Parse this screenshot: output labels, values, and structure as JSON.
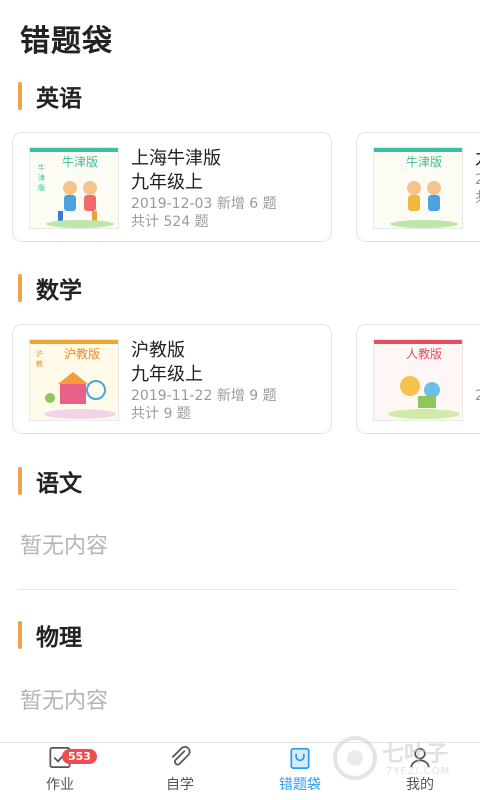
{
  "header": {
    "title": "错题袋"
  },
  "sections": [
    {
      "label": "英语",
      "cards": [
        {
          "cover_brand": "牛津版",
          "cover_side": "牛津版",
          "title": "上海牛津版",
          "grade": "九年级上",
          "date": "2019-12-03",
          "added": "新增 6 题",
          "total": "共计 524 题"
        },
        {
          "cover_brand": "牛津版",
          "cover_side": "牛津版",
          "title": "九",
          "grade": "2",
          "date": "2",
          "added": "",
          "total": "共"
        }
      ]
    },
    {
      "label": "数学",
      "cards": [
        {
          "cover_brand": "沪教版",
          "cover_side": "沪教版",
          "title": "沪教版",
          "grade": "九年级上",
          "date": "2019-11-22",
          "added": "新增 9 题",
          "total": "共计 9 题"
        },
        {
          "cover_brand": "人教版",
          "cover_side": "人教版",
          "title": "",
          "grade": "",
          "date": "2",
          "added": "",
          "total": ""
        }
      ]
    },
    {
      "label": "语文",
      "empty": "暂无内容"
    },
    {
      "label": "物理",
      "empty": "暂无内容"
    }
  ],
  "tabbar": {
    "items": [
      {
        "label": "作业",
        "badge": "553"
      },
      {
        "label": "自学"
      },
      {
        "label": "错题袋"
      },
      {
        "label": "我的"
      }
    ]
  },
  "watermark": {
    "text": "七叶子",
    "sub": "7YEZI.COM"
  },
  "colors": {
    "accent": "#f0a04b",
    "active_tab": "#2d9cf0",
    "badge": "#f04d4d",
    "muted": "#b5b5b5"
  }
}
